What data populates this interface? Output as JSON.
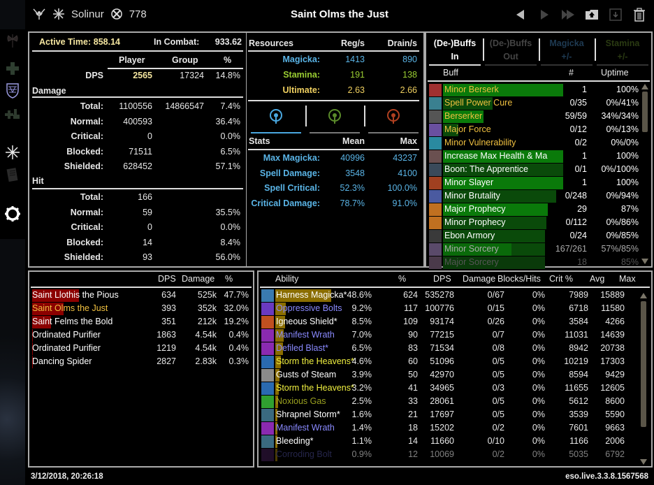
{
  "titlebar": {
    "player_name": "Solinur",
    "cp_value": "778",
    "fight_title": "Saint Olms the Just",
    "icons": [
      "class-icon",
      "alliance-icon",
      "champion-points-icon"
    ],
    "buttons": [
      "previous-fight-button",
      "next-fight-button",
      "last-fight-button",
      "upload-button",
      "save-button",
      "delete-button"
    ]
  },
  "sidebar": {
    "items": [
      {
        "name": "damage-out-tab",
        "icon": "axe-icon"
      },
      {
        "name": "healing-tab",
        "icon": "cross-icon"
      },
      {
        "name": "damage-in-tab",
        "icon": "shield-icon"
      },
      {
        "name": "group-tab",
        "icon": "group-icon"
      },
      {
        "name": "fight-overview-tab",
        "icon": "spark-icon"
      },
      {
        "name": "log-tab",
        "icon": "scroll-icon"
      },
      {
        "name": "settings-tab",
        "icon": "gear-icon"
      }
    ]
  },
  "fight": {
    "active_time_label": "Active Time:",
    "active_time": "858.14",
    "in_combat_label": "In Combat:",
    "in_combat": "933.62",
    "headers": [
      "Player",
      "Group",
      "%"
    ],
    "dps_label": "DPS",
    "dps": {
      "player": "2565",
      "group": "17324",
      "pct": "14.8%"
    },
    "damage_label": "Damage",
    "damage_rows": [
      {
        "label": "Total:",
        "player": "1100556",
        "group": "14866547",
        "pct": "7.4%"
      },
      {
        "label": "Normal:",
        "player": "400593",
        "group": "",
        "pct": "36.4%"
      },
      {
        "label": "Critical:",
        "player": "0",
        "group": "",
        "pct": "0.0%"
      },
      {
        "label": "Blocked:",
        "player": "71511",
        "group": "",
        "pct": "6.5%"
      },
      {
        "label": "Shielded:",
        "player": "628452",
        "group": "",
        "pct": "57.1%"
      }
    ],
    "hit_label": "Hit",
    "hit_rows": [
      {
        "label": "Total:",
        "player": "166",
        "pct": ""
      },
      {
        "label": "Normal:",
        "player": "59",
        "pct": "35.5%"
      },
      {
        "label": "Critical:",
        "player": "0",
        "pct": "0.0%"
      },
      {
        "label": "Blocked:",
        "player": "14",
        "pct": "8.4%"
      },
      {
        "label": "Shielded:",
        "player": "93",
        "pct": "56.0%"
      }
    ]
  },
  "resources": {
    "title": "Resources",
    "headers": [
      "Reg/s",
      "Drain/s"
    ],
    "rows": [
      {
        "label": "Magicka:",
        "reg": "1413",
        "drain": "890",
        "color": "#5ab4e6"
      },
      {
        "label": "Stamina:",
        "reg": "191",
        "drain": "138",
        "color": "#9acd32"
      },
      {
        "label": "Ultimate:",
        "reg": "2.63",
        "drain": "2.66",
        "color": "#f0d060"
      }
    ],
    "stat_tabs": [
      {
        "name": "magicka-stats-tab",
        "icon": "magicka-icon",
        "color": "#4aa8e0",
        "active": true
      },
      {
        "name": "stamina-stats-tab",
        "icon": "stamina-icon",
        "color": "#5a8a2a",
        "active": false
      },
      {
        "name": "health-stats-tab",
        "icon": "health-icon",
        "color": "#b04020",
        "active": false
      }
    ],
    "stats_title": "Stats",
    "stats_headers": [
      "Mean",
      "Max"
    ],
    "stats": [
      {
        "label": "Max Magicka:",
        "mean": "40996",
        "max": "43237"
      },
      {
        "label": "Spell Damage:",
        "mean": "3548",
        "max": "4100"
      },
      {
        "label": "Spell Critical:",
        "mean": "52.3%",
        "max": "100.0%"
      },
      {
        "label": "Critical Damage:",
        "mean": "78.7%",
        "max": "91.0%"
      }
    ]
  },
  "buffs": {
    "tabs": [
      {
        "line1": "(De-)Buffs",
        "line2": "In",
        "active": true,
        "color": "#ffffff"
      },
      {
        "line1": "(De-)Buffs",
        "line2": "Out",
        "active": false,
        "color": "#444444"
      },
      {
        "line1": "Magicka",
        "line2": "+/-",
        "active": false,
        "color": "#1e3a52"
      },
      {
        "line1": "Stamina",
        "line2": "+/-",
        "active": false,
        "color": "#2a3a12"
      }
    ],
    "headers": [
      "Buff",
      "#",
      "Uptime"
    ],
    "rows": [
      {
        "name": "Minor Berserk",
        "count": "1",
        "uptime": "100%",
        "uptime_frac": 1.0,
        "color": "#f0c040",
        "bar": "#0a7a0a",
        "icon": "#a03030"
      },
      {
        "name": "Spell Power Cure",
        "count": "0/35",
        "uptime": "0%/41%",
        "uptime_frac": 0.41,
        "color": "#f0c040",
        "bar": "#0a4a0a",
        "icon": "#3a8090"
      },
      {
        "name": "Berserker",
        "count": "59/59",
        "uptime": "34%/34%",
        "uptime_frac": 0.34,
        "color": "#f0c040",
        "bar": "#0a7a0a",
        "icon": "#555555"
      },
      {
        "name": "Major Force",
        "count": "0/12",
        "uptime": "0%/13%",
        "uptime_frac": 0.13,
        "color": "#f0c040",
        "bar": "#0a4a0a",
        "icon": "#6a50a0"
      },
      {
        "name": "Minor Vulnerability",
        "count": "0/2",
        "uptime": "0%/0%",
        "uptime_frac": 0.0,
        "color": "#f0c040",
        "bar": "#0a4a0a",
        "icon": "#2a8aa0"
      },
      {
        "name": "Increase Max Health & Ma",
        "count": "1",
        "uptime": "100%",
        "uptime_frac": 1.0,
        "color": "#ffffff",
        "bar": "#0a7a0a",
        "icon": "#6a5050"
      },
      {
        "name": "Boon: The Apprentice",
        "count": "0/1",
        "uptime": "0%/100%",
        "uptime_frac": 1.0,
        "color": "#ffffff",
        "bar": "#0a4a0a",
        "icon": "#3a4a5a"
      },
      {
        "name": "Minor Slayer",
        "count": "1",
        "uptime": "100%",
        "uptime_frac": 1.0,
        "color": "#ffffff",
        "bar": "#0a7a0a",
        "icon": "#a04020"
      },
      {
        "name": "Minor Brutality",
        "count": "0/248",
        "uptime": "0%/94%",
        "uptime_frac": 0.94,
        "color": "#ffffff",
        "bar": "#0a4a0a",
        "icon": "#4a5aa0"
      },
      {
        "name": "Major Prophecy",
        "count": "29",
        "uptime": "87%",
        "uptime_frac": 0.87,
        "color": "#ffffff",
        "bar": "#0a7a0a",
        "icon": "#c07020"
      },
      {
        "name": "Minor Prophecy",
        "count": "0/112",
        "uptime": "0%/86%",
        "uptime_frac": 0.86,
        "color": "#ffffff",
        "bar": "#0a4a0a",
        "icon": "#c07020"
      },
      {
        "name": "Ebon Armory",
        "count": "0/24",
        "uptime": "0%/85%",
        "uptime_frac": 0.85,
        "color": "#ffffff",
        "bar": "#0a4a0a",
        "icon": "#3a3a3a"
      },
      {
        "name": "Minor Sorcery",
        "count": "167/261",
        "uptime": "57%/85%",
        "uptime_frac": 0.85,
        "uptime_frac2": 0.57,
        "color": "#aaaaaa",
        "bar": "#0a4a0a",
        "icon": "#5a4a6a"
      },
      {
        "name": "Major Sorcery",
        "count": "18",
        "uptime": "85%",
        "uptime_frac": 0.85,
        "color": "#555555",
        "bar": "#0a3a0a",
        "icon": "#4a3a4a"
      }
    ]
  },
  "units": {
    "headers": [
      "DPS",
      "Damage",
      "%"
    ],
    "rows": [
      {
        "name": "Saint Llothis the Pious",
        "dps": "634",
        "damage": "525k",
        "pct": "47.7%",
        "share": 0.477,
        "color": "#ffffff"
      },
      {
        "name": "Saint Olms the Just",
        "dps": "393",
        "damage": "352k",
        "pct": "32.0%",
        "share": 0.32,
        "color": "#f0c040"
      },
      {
        "name": "Saint Felms the Bold",
        "dps": "351",
        "damage": "212k",
        "pct": "19.2%",
        "share": 0.192,
        "color": "#ffffff"
      },
      {
        "name": "Ordinated Purifier",
        "dps": "1863",
        "damage": "4.54k",
        "pct": "0.4%",
        "share": 0.004,
        "color": "#ffffff"
      },
      {
        "name": "Ordinated Purifier",
        "dps": "1219",
        "damage": "4.54k",
        "pct": "0.4%",
        "share": 0.004,
        "color": "#ffffff"
      },
      {
        "name": "Dancing Spider",
        "dps": "2827",
        "damage": "2.83k",
        "pct": "0.3%",
        "share": 0.003,
        "color": "#ffffff"
      }
    ]
  },
  "abilities": {
    "headers": [
      "Ability",
      "%",
      "DPS",
      "Damage",
      "Blocks/Hits",
      "Crit %",
      "Avg",
      "Max"
    ],
    "rows": [
      {
        "name": "Harness Magicka*",
        "pct": "48.6%",
        "dps": "624",
        "damage": "535278",
        "blocks_hits": "0/67",
        "crit": "0%",
        "avg": "7989",
        "max": "15889",
        "share": 0.486,
        "color": "#ffffff",
        "icon": "#3a7ab0"
      },
      {
        "name": "Oppressive Bolts",
        "pct": "9.2%",
        "dps": "117",
        "damage": "100776",
        "blocks_hits": "0/15",
        "crit": "0%",
        "avg": "6718",
        "max": "11580",
        "share": 0.092,
        "color": "#8a8aff",
        "icon": "#6a3ac0"
      },
      {
        "name": "Igneous Shield*",
        "pct": "8.5%",
        "dps": "109",
        "damage": "93174",
        "blocks_hits": "0/26",
        "crit": "0%",
        "avg": "3584",
        "max": "4266",
        "share": 0.085,
        "color": "#ffffff",
        "icon": "#c05020"
      },
      {
        "name": "Manifest Wrath",
        "pct": "7.0%",
        "dps": "90",
        "damage": "77215",
        "blocks_hits": "0/7",
        "crit": "0%",
        "avg": "11031",
        "max": "14639",
        "share": 0.07,
        "color": "#8a8aff",
        "icon": "#8a2ab0"
      },
      {
        "name": "Defiled Blast*",
        "pct": "6.5%",
        "dps": "83",
        "damage": "71534",
        "blocks_hits": "0/8",
        "crit": "0%",
        "avg": "8942",
        "max": "20738",
        "share": 0.065,
        "color": "#8a8aff",
        "icon": "#8a2ab0"
      },
      {
        "name": "Storm the Heavens*",
        "pct": "4.6%",
        "dps": "60",
        "damage": "51096",
        "blocks_hits": "0/5",
        "crit": "0%",
        "avg": "10219",
        "max": "17303",
        "share": 0.046,
        "color": "#f0f040",
        "icon": "#2a6ab0"
      },
      {
        "name": "Gusts of Steam",
        "pct": "3.9%",
        "dps": "50",
        "damage": "42970",
        "blocks_hits": "0/5",
        "crit": "0%",
        "avg": "8594",
        "max": "9429",
        "share": 0.039,
        "color": "#ffffff",
        "icon": "#8a8a8a"
      },
      {
        "name": "Storm the Heavens*",
        "pct": "3.2%",
        "dps": "41",
        "damage": "34965",
        "blocks_hits": "0/3",
        "crit": "0%",
        "avg": "11655",
        "max": "12605",
        "share": 0.032,
        "color": "#f0f040",
        "icon": "#2a6ab0"
      },
      {
        "name": "Noxious Gas",
        "pct": "2.5%",
        "dps": "33",
        "damage": "28061",
        "blocks_hits": "0/5",
        "crit": "0%",
        "avg": "5612",
        "max": "8600",
        "share": 0.025,
        "color": "#9aa020",
        "icon": "#30a030"
      },
      {
        "name": "Shrapnel Storm*",
        "pct": "1.6%",
        "dps": "21",
        "damage": "17697",
        "blocks_hits": "0/5",
        "crit": "0%",
        "avg": "3539",
        "max": "5590",
        "share": 0.016,
        "color": "#ffffff",
        "icon": "#3a6a80"
      },
      {
        "name": "Manifest Wrath",
        "pct": "1.4%",
        "dps": "18",
        "damage": "15202",
        "blocks_hits": "0/2",
        "crit": "0%",
        "avg": "7601",
        "max": "9663",
        "share": 0.014,
        "color": "#8a8aff",
        "icon": "#8a2ab0"
      },
      {
        "name": "Bleeding*",
        "pct": "1.1%",
        "dps": "14",
        "damage": "11660",
        "blocks_hits": "0/10",
        "crit": "0%",
        "avg": "1166",
        "max": "2006",
        "share": 0.011,
        "color": "#ffffff",
        "icon": "#3a6a80"
      },
      {
        "name": "Corroding Bolt",
        "pct": "0.9%",
        "dps": "12",
        "damage": "10069",
        "blocks_hits": "0/2",
        "crit": "0%",
        "avg": "5035",
        "max": "6792",
        "share": 0.009,
        "color": "#444488",
        "icon": "#3a1a4a",
        "dim": true
      }
    ]
  },
  "footer": {
    "timestamp": "3/12/2018, 20:26:18",
    "version": "eso.live.3.3.8.1567568"
  }
}
